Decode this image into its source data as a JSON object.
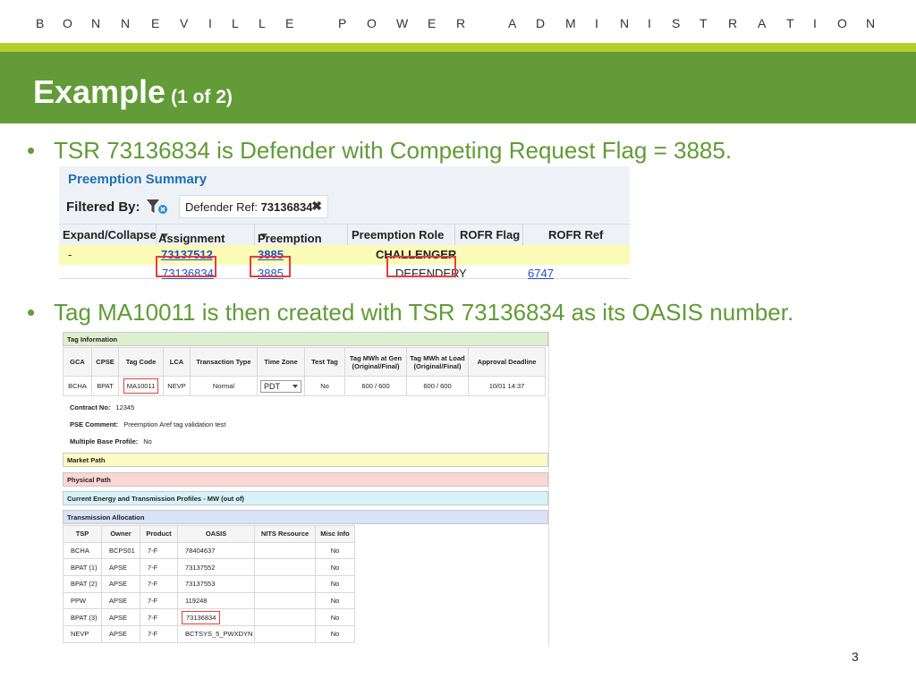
{
  "header": {
    "org_letters": [
      "B",
      "O",
      "N",
      "N",
      "E",
      "V",
      "I",
      "L",
      "L",
      "E",
      "P",
      "O",
      "W",
      "E",
      "R",
      "A",
      "D",
      "M",
      "I",
      "N",
      "I",
      "S",
      "T",
      "R",
      "A",
      "T",
      "I",
      "O",
      "N"
    ]
  },
  "slide": {
    "title": "Example",
    "subtitle": "(1 of 2)",
    "page_number": "3",
    "colors": {
      "green": "#629b37",
      "lime": "#b5cf2a",
      "highlight_red": "#e04040"
    }
  },
  "bullets": [
    {
      "text": "TSR 73136834 is Defender with Competing Request Flag = 3885."
    },
    {
      "text": "Tag MA10011 is then created with TSR 73136834 as its OASIS number."
    }
  ],
  "preemption_summary": {
    "title": "Preemption Summary",
    "filtered_by_label": "Filtered By:",
    "filter_icon": "filter-icon",
    "chip_label": "Defender Ref:",
    "chip_value": "73136834",
    "chip_close": "✖",
    "columns": [
      "Expand/Collapse",
      "Assignment Ref",
      "Preemption Ref",
      "Preemption Role",
      "ROFR Flag",
      "ROFR Ref"
    ],
    "rows": [
      {
        "expand": "-",
        "assignment_ref": "73137512",
        "preemption_ref": "3885",
        "role": "CHALLENGER",
        "rofr_flag": "",
        "rofr_ref": ""
      },
      {
        "expand": "",
        "assignment_ref": "73136834",
        "preemption_ref": "3885",
        "role": "DEFENDER",
        "rofr_flag": "Y",
        "rofr_ref": "6747"
      }
    ]
  },
  "tag_info": {
    "section_title": "Tag Information",
    "columns": [
      "GCA",
      "CPSE",
      "Tag Code",
      "LCA",
      "Transaction Type",
      "Time Zone",
      "Test Tag",
      "Tag MWh at Gen (Original/Final)",
      "Tag MWh at Load (Original/Final)",
      "Approval Deadline"
    ],
    "row": {
      "gca": "BCHA",
      "cpse": "BPAT",
      "tag_code": "MA10011",
      "lca": "NEVP",
      "transaction_type": "Normal",
      "time_zone": "PDT",
      "test_tag": "No",
      "mwh_gen": "600 / 600",
      "mwh_load": "600 / 600",
      "approval_deadline": "10/01 14:37"
    },
    "contract_no_label": "Contract No:",
    "contract_no": "12345",
    "pse_comment_label": "PSE Comment:",
    "pse_comment": "Preemption Aref tag validation test",
    "multiple_base_label": "Multiple Base Profile:",
    "multiple_base": "No",
    "sections": {
      "market_path": "Market Path",
      "physical_path": "Physical Path",
      "current_energy": "Current Energy and Transmission Profiles - MW (out of)",
      "transmission_allocation": "Transmission Allocation"
    }
  },
  "transmission_allocation": {
    "columns": [
      "TSP",
      "Owner",
      "Product",
      "OASIS",
      "NITS Resource",
      "Misc Info"
    ],
    "rows": [
      {
        "tsp": "BCHA",
        "owner": "BCPS01",
        "product": "7-F",
        "oasis": "78404637",
        "nits": "",
        "misc": "No"
      },
      {
        "tsp": "BPAT (1)",
        "owner": "APSE",
        "product": "7-F",
        "oasis": "73137552",
        "nits": "",
        "misc": "No"
      },
      {
        "tsp": "BPAT (2)",
        "owner": "APSE",
        "product": "7-F",
        "oasis": "73137553",
        "nits": "",
        "misc": "No"
      },
      {
        "tsp": "PPW",
        "owner": "APSE",
        "product": "7-F",
        "oasis": "119248",
        "nits": "",
        "misc": "No"
      },
      {
        "tsp": "BPAT (3)",
        "owner": "APSE",
        "product": "7-F",
        "oasis": "73136834",
        "nits": "",
        "misc": "No"
      },
      {
        "tsp": "NEVP",
        "owner": "APSE",
        "product": "7-F",
        "oasis": "BCTSYS_5_PWXDYN",
        "nits": "",
        "misc": "No"
      }
    ]
  }
}
